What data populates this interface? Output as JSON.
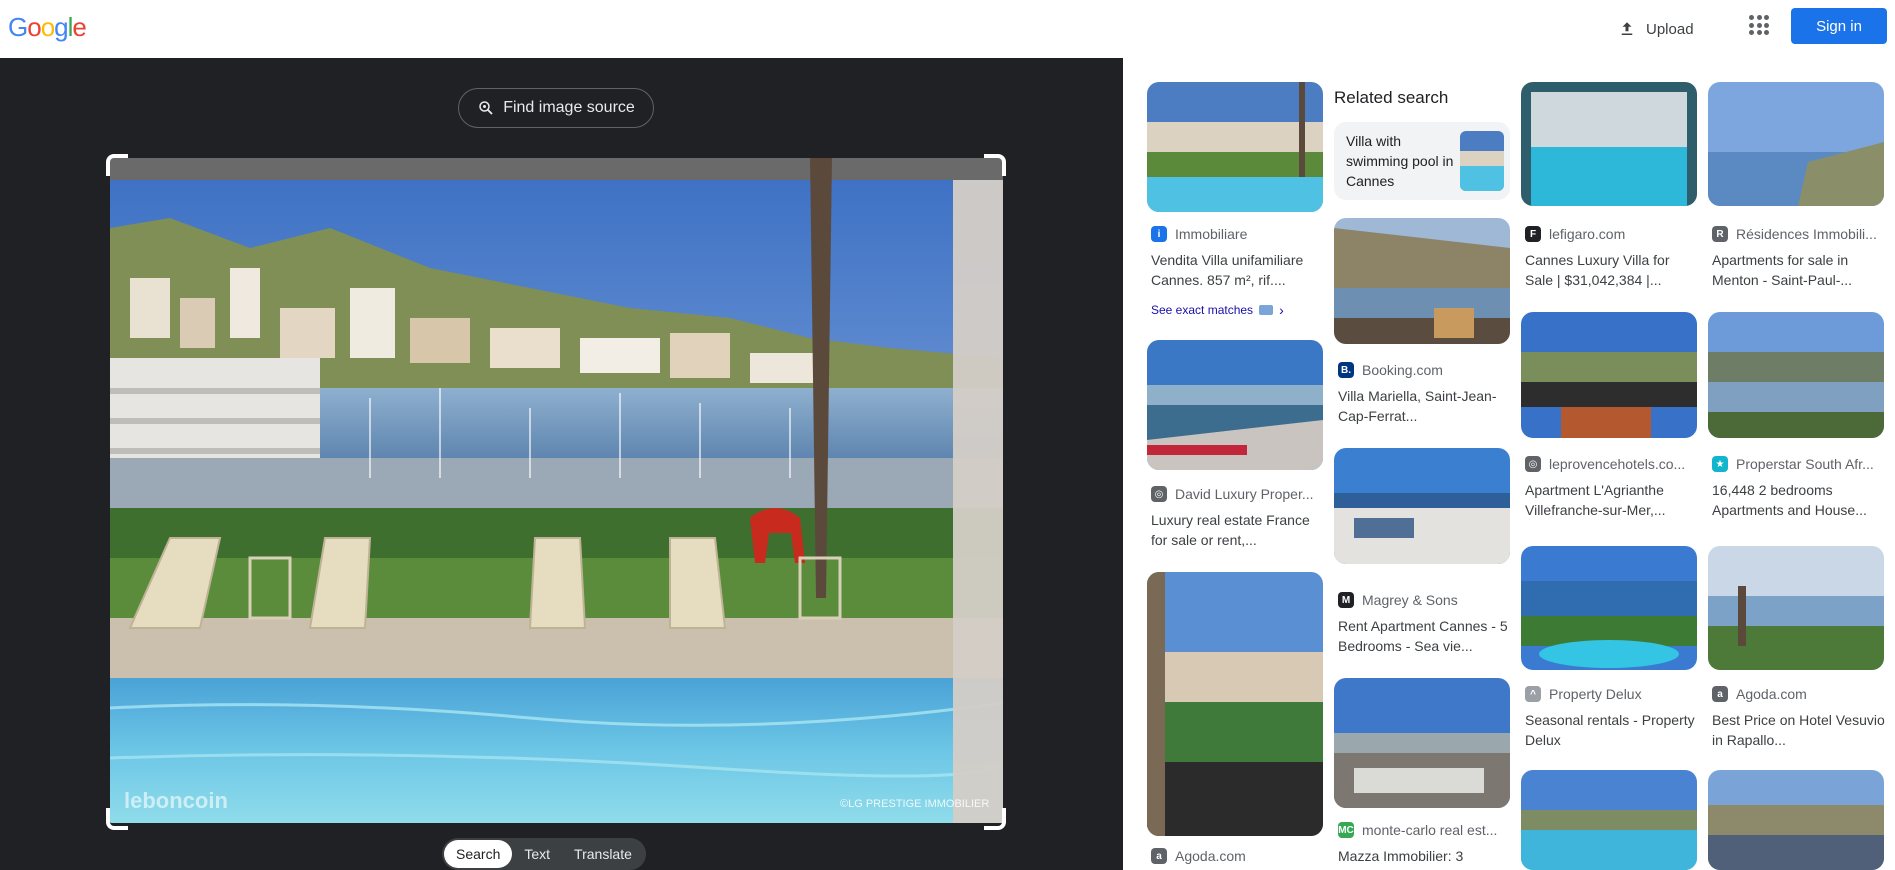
{
  "header": {
    "logo": [
      {
        "ch": "G",
        "color": "#4285F4"
      },
      {
        "ch": "o",
        "color": "#EA4335"
      },
      {
        "ch": "o",
        "color": "#FBBC05"
      },
      {
        "ch": "g",
        "color": "#4285F4"
      },
      {
        "ch": "l",
        "color": "#34A853"
      },
      {
        "ch": "e",
        "color": "#EA4335"
      }
    ],
    "upload_label": "Upload",
    "signin_label": "Sign in"
  },
  "lens": {
    "find_source_label": "Find image source",
    "watermark_left": "leboncoin",
    "watermark_right": "©LG PRESTIGE IMMOBILIER",
    "modes": [
      "Search",
      "Text",
      "Translate"
    ],
    "active_mode": "Search"
  },
  "results": {
    "related": {
      "heading": "Related search",
      "query": "Villa with swimming pool in Cannes"
    },
    "exact_matches_label": "See exact matches",
    "cards": [
      {
        "source": "Immobiliare",
        "title": "Vendita Villa unifamiliare Cannes. 857 m², rif....",
        "fav_color": "#1a73e8",
        "fav_glyph": "i"
      },
      {
        "source": "David Luxury Proper...",
        "title": "Luxury real estate France for sale or rent,...",
        "fav_color": "#5f6368",
        "fav_glyph": "◎"
      },
      {
        "source": "Agoda.com",
        "title": "",
        "fav_color": "#5f6368",
        "fav_glyph": "a"
      },
      {
        "source": "Booking.com",
        "title": "Villa Mariella, Saint-Jean-Cap-Ferrat...",
        "fav_color": "#003580",
        "fav_glyph": "B."
      },
      {
        "source": "Magrey & Sons",
        "title": "Rent Apartment Cannes - 5 Bedrooms - Sea vie...",
        "fav_color": "#202124",
        "fav_glyph": "M"
      },
      {
        "source": "monte-carlo real est...",
        "title": "Mazza Immobilier: 3",
        "fav_color": "#34A853",
        "fav_glyph": "MC"
      },
      {
        "source": "lefigaro.com",
        "title": "Cannes Luxury Villa for Sale | $31,042,384 |...",
        "fav_color": "#202124",
        "fav_glyph": "F"
      },
      {
        "source": "leprovencehotels.co...",
        "title": "Apartment L'Agrianthe Villefranche-sur-Mer,...",
        "fav_color": "#5f6368",
        "fav_glyph": "◎"
      },
      {
        "source": "Property Delux",
        "title": "Seasonal rentals - Property Delux",
        "fav_color": "#9aa0a6",
        "fav_glyph": "^"
      },
      {
        "source": "Résidences Immobili...",
        "title": "Apartments for sale in Menton - Saint-Paul-...",
        "fav_color": "#5f6368",
        "fav_glyph": "R"
      },
      {
        "source": "Properstar South Afr...",
        "title": "16,448 2 bedrooms Apartments and House...",
        "fav_color": "#12b5cb",
        "fav_glyph": "★"
      },
      {
        "source": "Agoda.com",
        "title": "Best Price on Hotel Vesuvio in Rapallo...",
        "fav_color": "#5f6368",
        "fav_glyph": "a"
      }
    ]
  },
  "colors": {
    "accent": "#1a73e8",
    "dark_panel": "#202124",
    "link": "#1a0dab"
  }
}
